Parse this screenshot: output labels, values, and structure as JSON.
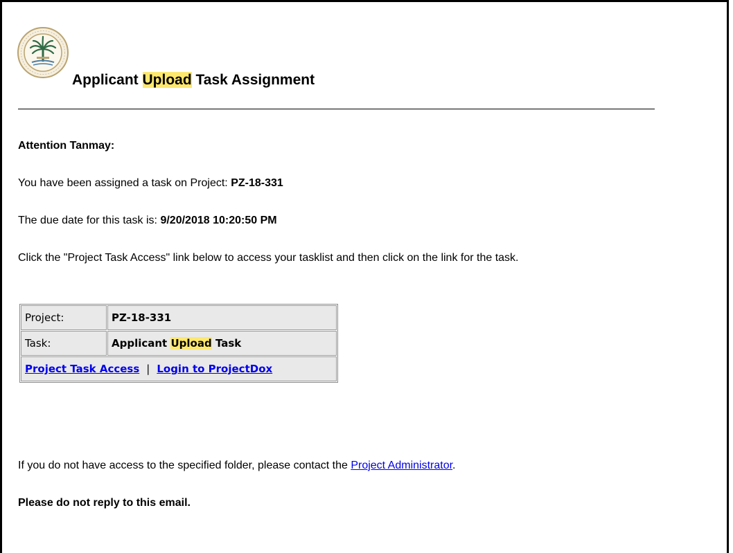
{
  "email": {
    "title_prefix": "Applicant",
    "title_highlight": "Upload",
    "title_suffix": "Task Assignment",
    "attention": "Attention Tanmay:",
    "assigned_text": "You have been assigned a task on Project:",
    "project_number": "PZ-18-331",
    "due_text": "The due date for this task is:",
    "due_date": "9/20/2018 10:20:50 PM",
    "instructions": "Click the \"Project Task Access\" link below to access your tasklist and then click on the link for the task.",
    "table": {
      "project_label": "Project:",
      "project_value": "PZ-18-331",
      "task_label": "Task:",
      "task_value_prefix": "Applicant",
      "task_value_highlight": "Upload",
      "task_value_suffix": "Task",
      "link_task_access": "Project Task Access",
      "separator": "|",
      "link_login": "Login to ProjectDox"
    },
    "no_access_text": "If you do not have access to the specified folder, please contact the",
    "admin_link": "Project Administrator",
    "no_access_end": ".",
    "no_reply": "Please do not reply to this email."
  },
  "colors": {
    "highlight": "#fde86e",
    "link": "#0000ee",
    "table_cell_bg": "#e9e9e9"
  },
  "icons": {
    "seal": "city-seal-icon"
  }
}
